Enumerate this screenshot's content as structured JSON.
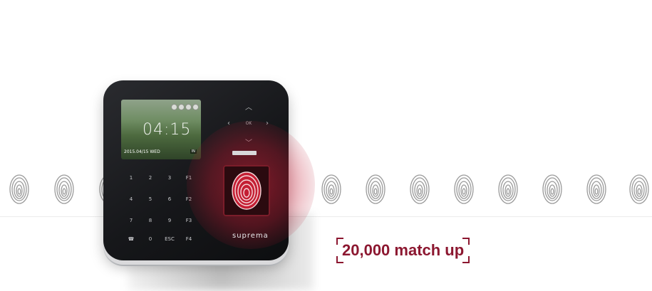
{
  "device": {
    "screen_time": "04:15",
    "screen_date": "2015.04/15 WED",
    "screen_badge": "IN",
    "brand": "suprema",
    "nav_ok": "OK",
    "keypad": [
      "1",
      "2",
      "3",
      "F1",
      "4",
      "5",
      "6",
      "F2",
      "7",
      "8",
      "9",
      "F3",
      "☎",
      "0",
      "ESC",
      "F4"
    ]
  },
  "tagline": "20,000 match up",
  "colors": {
    "accent": "#8c1730",
    "glow": "#d81e37"
  },
  "icons": [
    "fingerprint-icon"
  ]
}
